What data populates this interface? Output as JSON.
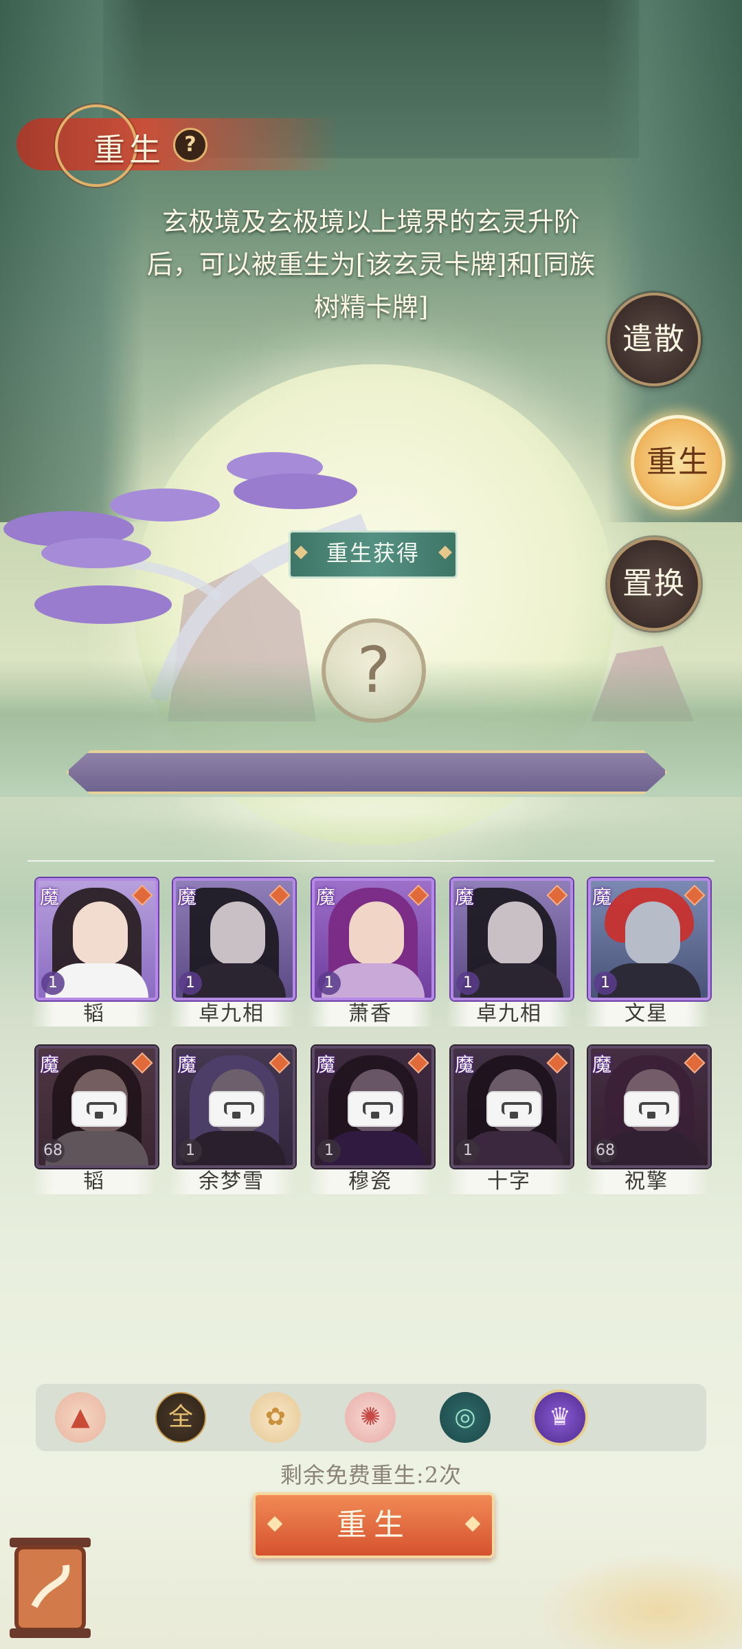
{
  "header": {
    "title": "重生",
    "help_icon": "?"
  },
  "description": "玄极境及玄极境以上境界的玄灵升阶后，可以被重生为[该玄灵卡牌]和[同族树精卡牌]",
  "side_tabs": [
    {
      "label": "遣散",
      "active": false
    },
    {
      "label": "重生",
      "active": true
    },
    {
      "label": "置换",
      "active": false
    }
  ],
  "result_panel": {
    "label": "重生获得",
    "placeholder": "?"
  },
  "cards": [
    {
      "name": "韬",
      "tag": "魔",
      "level": "1",
      "active": true
    },
    {
      "name": "卓九相",
      "tag": "魔",
      "level": "1",
      "active": true
    },
    {
      "name": "萧香",
      "tag": "魔",
      "level": "1",
      "active": true
    },
    {
      "name": "卓九相",
      "tag": "魔",
      "level": "1",
      "active": true
    },
    {
      "name": "文星",
      "tag": "魔",
      "level": "1",
      "active": true
    },
    {
      "name": "韬",
      "tag": "魔",
      "level": "68",
      "active": false
    },
    {
      "name": "余梦雪",
      "tag": "魔",
      "level": "1",
      "active": false
    },
    {
      "name": "穆瓷",
      "tag": "魔",
      "level": "1",
      "active": false
    },
    {
      "name": "十字",
      "tag": "魔",
      "level": "1",
      "active": false
    },
    {
      "name": "祝擎",
      "tag": "魔",
      "level": "68",
      "active": false
    }
  ],
  "factions": [
    {
      "icon": "all-faction-icon",
      "glyph": "▲",
      "color": "#c94a36"
    },
    {
      "icon": "gold-faction-icon",
      "glyph": "全",
      "color": "#b88a3a"
    },
    {
      "icon": "lotus-faction-icon",
      "glyph": "✿",
      "color": "#c9913e"
    },
    {
      "icon": "spider-faction-icon",
      "glyph": "✺",
      "color": "#c64a46"
    },
    {
      "icon": "water-faction-icon",
      "glyph": "◎",
      "color": "#3a8a86"
    },
    {
      "icon": "demon-faction-icon",
      "glyph": "♛",
      "color": "#7a4ac4"
    }
  ],
  "remaining_text": "剩余免费重生:2次",
  "action_button": "重生"
}
